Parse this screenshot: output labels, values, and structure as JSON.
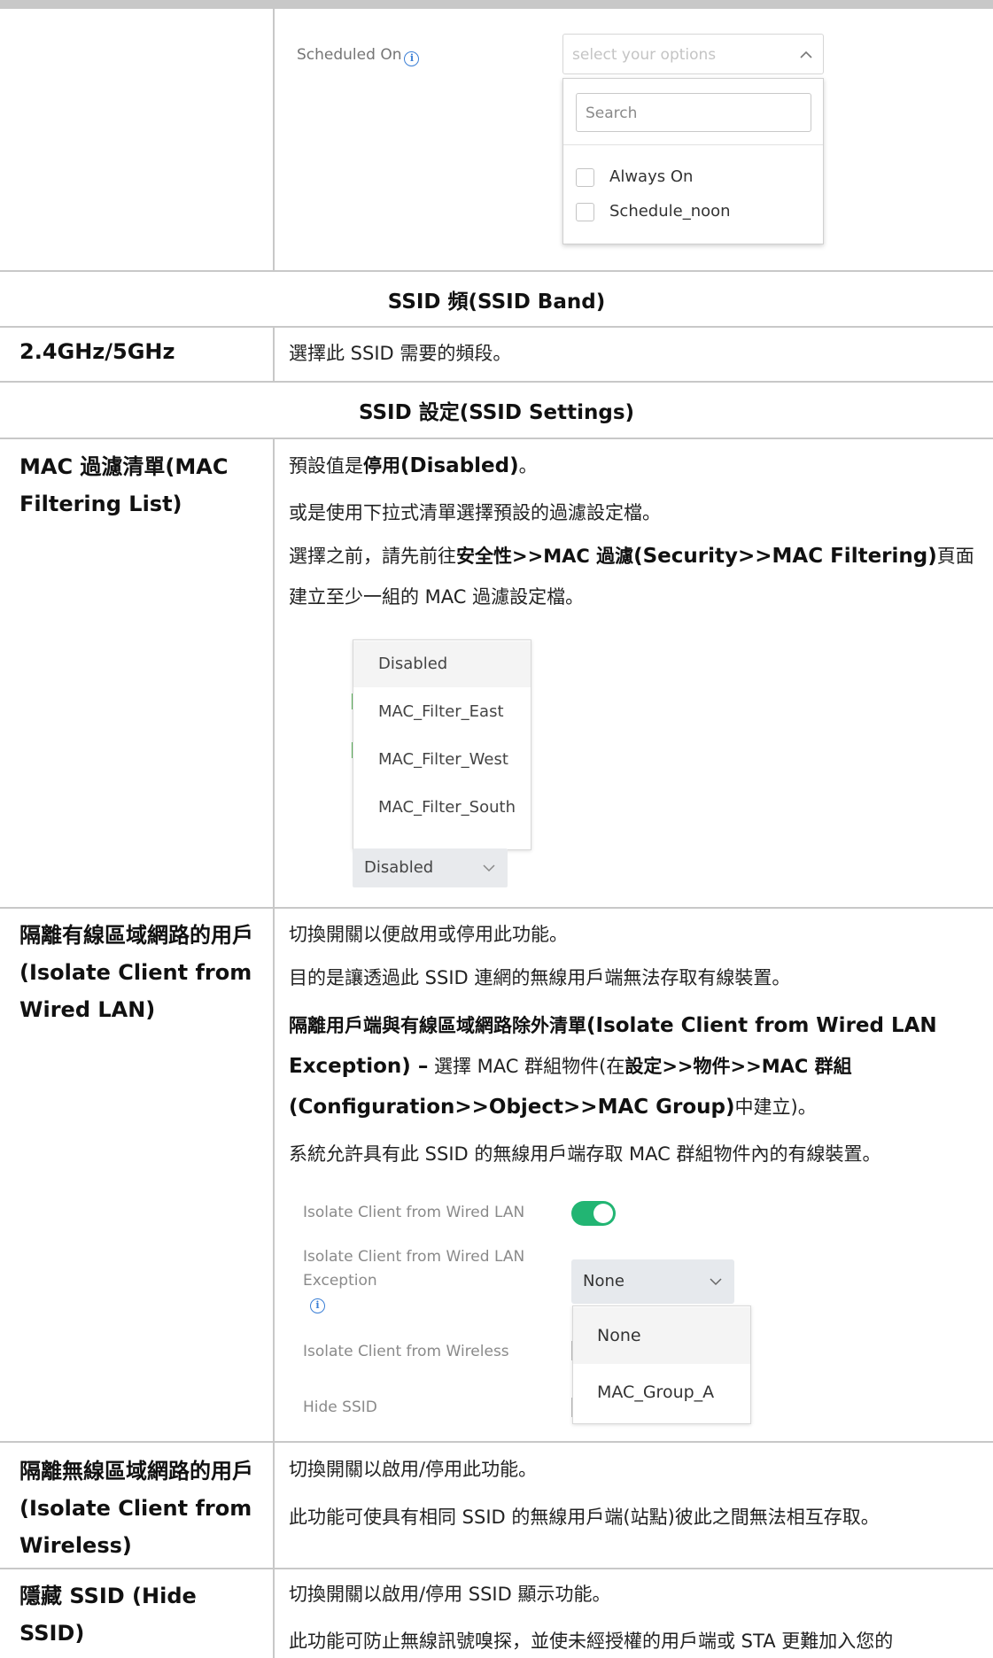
{
  "scheduled": {
    "label": "Scheduled On",
    "placeholder": "select your options",
    "search_placeholder": "Search",
    "options": [
      "Always On",
      "Schedule_noon"
    ]
  },
  "band_section": {
    "header": "SSID 頻(SSID Band)",
    "term": "2.4GHz/5GHz",
    "desc": "選擇此 SSID 需要的頻段。"
  },
  "settings_section": {
    "header": "SSID 設定(SSID Settings)"
  },
  "mac_filter": {
    "term": "MAC 過濾清單(MAC Filtering List)",
    "p1_pre": "預設值是",
    "p1_bold": "停用",
    "p1_en": "(Disabled)",
    "p1_post": "。",
    "p2": "或是使用下拉式清單選擇預設的過濾設定檔。",
    "p3_pre": "選擇之前，請先前往",
    "p3_bold": "安全性>>MAC 過濾",
    "p3_en": "(Security>>MAC Filtering)",
    "p3_post": "頁面建立至少一組的 MAC 過濾設定檔。",
    "dropdown_options": [
      "Disabled",
      "MAC_Filter_East",
      "MAC_Filter_West",
      "MAC_Filter_South"
    ],
    "selected": "Disabled"
  },
  "isolate_wired": {
    "term": "隔離有線區域網路的用戶 (Isolate Client from Wired LAN)",
    "p1": "切換開關以便啟用或停用此功能。",
    "p2": "目的是讓透過此 SSID 連網的無線用戶端無法存取有線裝置。",
    "p3_bold": "隔離用戶端與有線區域網路除外清單",
    "p3_en_a": "(Isolate Client from Wired LAN",
    "p3_en_b": "Exception) –",
    "p3_mid": " 選擇 MAC 群組物件(在",
    "p3_bold2": "設定>>物件>>MAC 群組",
    "p3_en_c": "(Configuration>>Object>>MAC Group)",
    "p3_post": "中建立)。",
    "p4": "系統允許具有此 SSID 的無線用戶端存取 MAC 群組物件內的有線裝置。",
    "ui": {
      "label_toggle": "Isolate Client from Wired LAN",
      "toggle_on": true,
      "label_exception": "Isolate Client from Wired LAN Exception",
      "label_wireless": "Isolate Client from Wireless",
      "label_hide": "Hide SSID",
      "exception_selected": "None",
      "exception_options": [
        "None",
        "MAC_Group_A"
      ],
      "accent": "#22b573"
    }
  },
  "isolate_wireless": {
    "term": "隔離無線區域網路的用戶 (Isolate Client from Wireless)",
    "p1": "切換開關以啟用/停用此功能。",
    "p2": "此功能可使具有相同  SSID  的無線用戶端(站點)彼此之間無法相互存取。"
  },
  "hide_ssid": {
    "term": "隱藏 SSID (Hide SSID)",
    "p1": "切換開關以啟用/停用 SSID 顯示功能。",
    "p2": "此功能可防止無線訊號嗅探，並使未經授權的用戶端或 STA 更難加入您的"
  }
}
